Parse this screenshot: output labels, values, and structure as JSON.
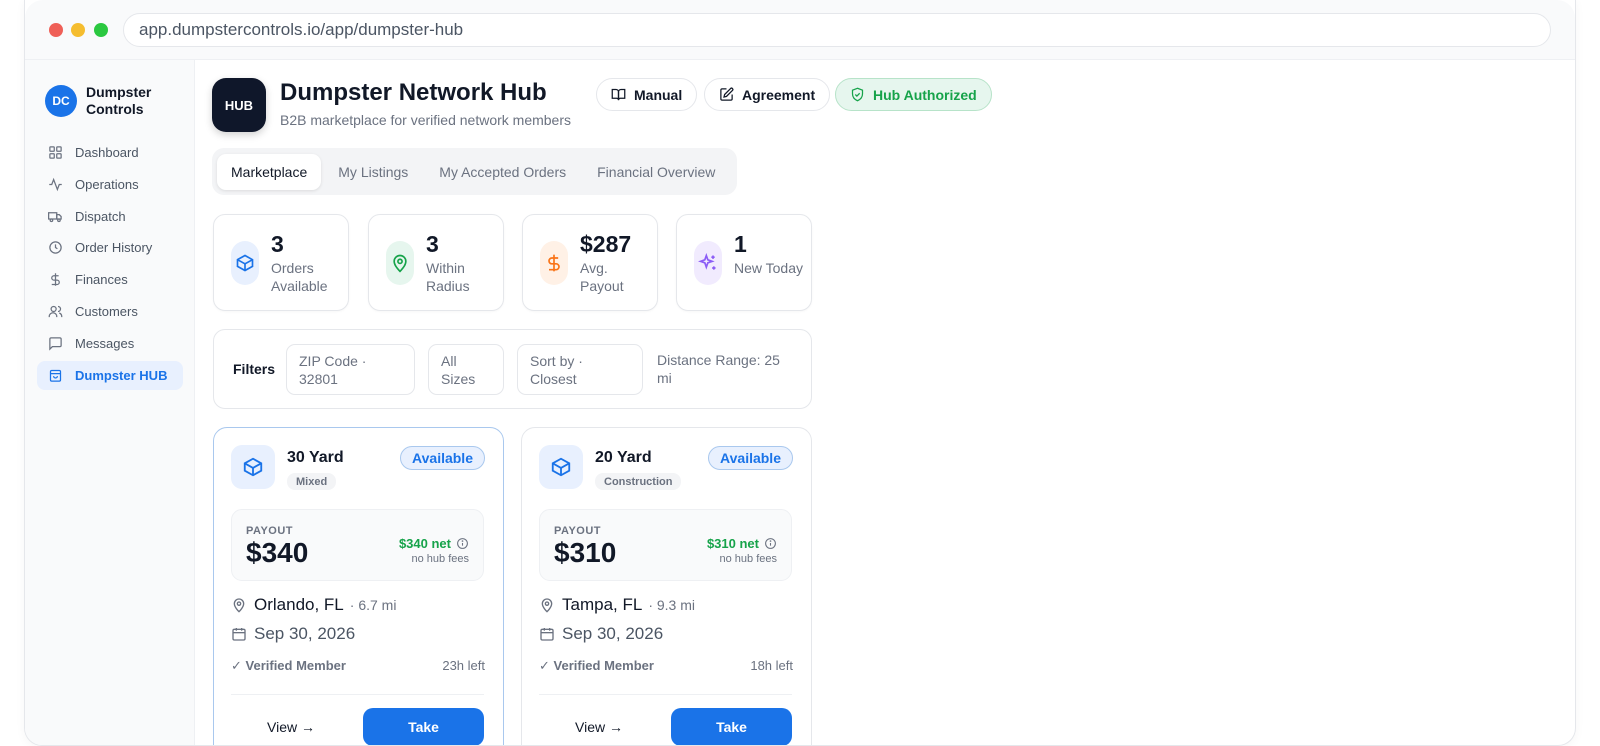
{
  "browser": {
    "url": "app.dumpstercontrols.io/app/dumpster-hub"
  },
  "sidebar": {
    "brand_initials": "DC",
    "brand_name": "Dumpster Controls",
    "items": [
      {
        "label": "Dashboard",
        "icon": "grid-icon"
      },
      {
        "label": "Operations",
        "icon": "activity-icon"
      },
      {
        "label": "Dispatch",
        "icon": "truck-icon"
      },
      {
        "label": "Order History",
        "icon": "clock-icon"
      },
      {
        "label": "Finances",
        "icon": "dollar-icon"
      },
      {
        "label": "Customers",
        "icon": "users-icon"
      },
      {
        "label": "Messages",
        "icon": "message-icon"
      },
      {
        "label": "Dumpster HUB",
        "icon": "bag-icon",
        "active": true
      }
    ]
  },
  "header": {
    "logo_text": "HUB",
    "title": "Dumpster Network Hub",
    "subtitle": "B2B marketplace for verified network members",
    "manual_label": "Manual",
    "agreement_label": "Agreement",
    "authorized_label": "Hub Authorized"
  },
  "tabs": [
    {
      "label": "Marketplace",
      "active": true
    },
    {
      "label": "My Listings"
    },
    {
      "label": "My Accepted Orders"
    },
    {
      "label": "Financial Overview"
    }
  ],
  "stats": [
    {
      "value": "3",
      "label": "Orders Available",
      "icon": "box-icon",
      "color": "#1a73e8"
    },
    {
      "value": "3",
      "label": "Within Radius",
      "icon": "map-pin-icon",
      "color": "#16a34a"
    },
    {
      "value": "$287",
      "label": "Avg. Payout",
      "icon": "dollar-icon",
      "color": "#f97316"
    },
    {
      "value": "1",
      "label": "New Today",
      "icon": "sparkle-icon",
      "color": "#8b5cf6"
    }
  ],
  "filters": {
    "label": "Filters",
    "zip": "ZIP Code · 32801",
    "sizes": "All Sizes",
    "sort": "Sort by · Closest",
    "range": "Distance Range: 25 mi"
  },
  "listings": [
    {
      "size": "30 Yard",
      "type": "Mixed",
      "status": "Available",
      "payout_label": "PAYOUT",
      "payout": "$340",
      "net": "$340 net",
      "fee_note": "no hub fees",
      "city": "Orlando, FL",
      "distance": "· 6.7 mi",
      "date": "Sep 30, 2026",
      "verified": "✓ Verified Member",
      "time_left": "23h left",
      "view_label": "View →",
      "take_label": "Take"
    },
    {
      "size": "20 Yard",
      "type": "Construction",
      "status": "Available",
      "payout_label": "PAYOUT",
      "payout": "$310",
      "net": "$310 net",
      "fee_note": "no hub fees",
      "city": "Tampa, FL",
      "distance": "· 9.3 mi",
      "date": "Sep 30, 2026",
      "verified": "✓ Verified Member",
      "time_left": "18h left",
      "view_label": "View →",
      "take_label": "Take"
    }
  ],
  "colors": {
    "accent": "#1a73e8",
    "success": "#16a34a",
    "sidebar_bg": "#f9fafb"
  }
}
